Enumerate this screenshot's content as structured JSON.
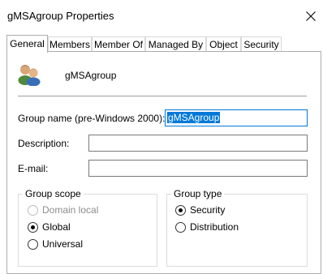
{
  "window": {
    "title": "gMSAgroup Properties"
  },
  "tabs": [
    {
      "label": "General",
      "active": true
    },
    {
      "label": "Members",
      "active": false
    },
    {
      "label": "Member Of",
      "active": false
    },
    {
      "label": "Managed By",
      "active": false
    },
    {
      "label": "Object",
      "active": false
    },
    {
      "label": "Security",
      "active": false
    }
  ],
  "general": {
    "icon": "group-users-icon",
    "group_heading": "gMSAgroup",
    "pre_win2000": {
      "label": "Group name (pre-Windows 2000):",
      "value": "gMSAgroup"
    },
    "description": {
      "label": "Description:",
      "value": ""
    },
    "email": {
      "label": "E-mail:",
      "value": ""
    }
  },
  "group_scope": {
    "title": "Group scope",
    "options": [
      {
        "label": "Domain local",
        "selected": false,
        "enabled": false
      },
      {
        "label": "Global",
        "selected": true,
        "enabled": true
      },
      {
        "label": "Universal",
        "selected": false,
        "enabled": true
      }
    ]
  },
  "group_type": {
    "title": "Group type",
    "options": [
      {
        "label": "Security",
        "selected": true,
        "enabled": true
      },
      {
        "label": "Distribution",
        "selected": false,
        "enabled": true
      }
    ]
  },
  "colors": {
    "selection": "#0078d7",
    "focus_border": "#0078d7",
    "disabled_text": "#8c8c8c"
  }
}
